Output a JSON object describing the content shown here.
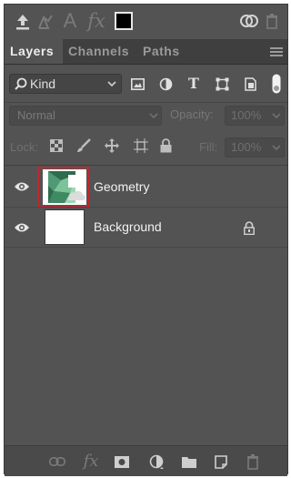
{
  "tabs": [
    {
      "label": "Layers",
      "active": true
    },
    {
      "label": "Channels",
      "active": false
    },
    {
      "label": "Paths",
      "active": false
    }
  ],
  "filter": {
    "kind_label": "Kind",
    "icons": [
      "image-filter-icon",
      "adjustment-filter-icon",
      "type-filter-icon",
      "shape-filter-icon",
      "smart-object-filter-icon",
      "filter-toggle-icon"
    ]
  },
  "blend": {
    "mode": "Normal",
    "opacity_label": "Opacity:",
    "opacity_value": "100%"
  },
  "lock": {
    "label": "Lock:",
    "fill_label": "Fill:",
    "fill_value": "100%"
  },
  "layers": [
    {
      "name": "Geometry",
      "visible": true,
      "selected_thumb": true,
      "locked": false
    },
    {
      "name": "Background",
      "visible": true,
      "selected_thumb": false,
      "locked": true
    }
  ],
  "colors": {
    "panel": "#535353",
    "tabbar": "#3f3f3f",
    "selection_outline": "#c1272d",
    "text": "#f2f2f2"
  }
}
